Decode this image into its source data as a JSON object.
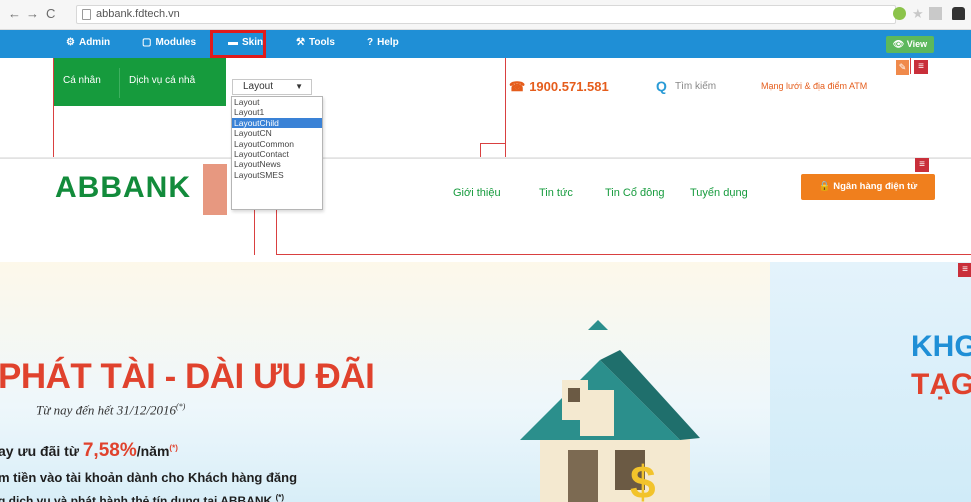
{
  "browser": {
    "back_glyph": "←",
    "forward_glyph": "→",
    "reload_glyph": "C",
    "url": "abbank.fdtech.vn"
  },
  "adminbar": {
    "items": [
      {
        "icon": "⚙",
        "label": "Admin"
      },
      {
        "icon": "▢",
        "label": "Modules"
      },
      {
        "icon": "▬",
        "label": "Skin"
      },
      {
        "icon": "⚒",
        "label": "Tools"
      },
      {
        "icon": "?",
        "label": "Help"
      }
    ],
    "view_label": "👁 View",
    "accent": "#1f8fd6",
    "highlight": "#e01b1b"
  },
  "header": {
    "tabs": [
      "Cá nhân",
      "Dịch vụ cá nhâ"
    ],
    "layout_select": {
      "value": "Layout",
      "options": [
        "Layout",
        "Layout1",
        "LayoutChild",
        "LayoutCN",
        "LayoutCommon",
        "LayoutContact",
        "LayoutNews",
        "LayoutSMES"
      ],
      "selected": "LayoutChild"
    },
    "hotline": "1900.571.581",
    "search_placeholder": "Tìm kiếm",
    "branch_link": "Mạng lưới & địa điểm ATM"
  },
  "logobar": {
    "logo": "ABBANK",
    "nav": [
      "Giới thiệu",
      "Tin tức",
      "Tin Cổ đông",
      "Tuyển dụng"
    ],
    "ebank_button": "🔒 Ngân hàng điện tử",
    "brand_green": "#128b3b",
    "orange": "#f07f1d"
  },
  "banner": {
    "title": "PHÁT TÀI - DÀI ƯU ĐÃI",
    "subtitle": "Từ nay đến hết 31/12/2016",
    "subtitle_note": "(*)",
    "rate_prefix": "ay ưu đãi từ ",
    "rate_value": "7,58%",
    "rate_suffix": "/năm",
    "rate_note": "(*)",
    "line2": "m tiền vào tài khoản dành cho Khách hàng đăng",
    "line3": "g dịch vụ và phát hành thẻ tín dụng tại ABBANK",
    "line3_note": "(*)",
    "right_line1": "KHG",
    "right_line2": "TẠG"
  }
}
